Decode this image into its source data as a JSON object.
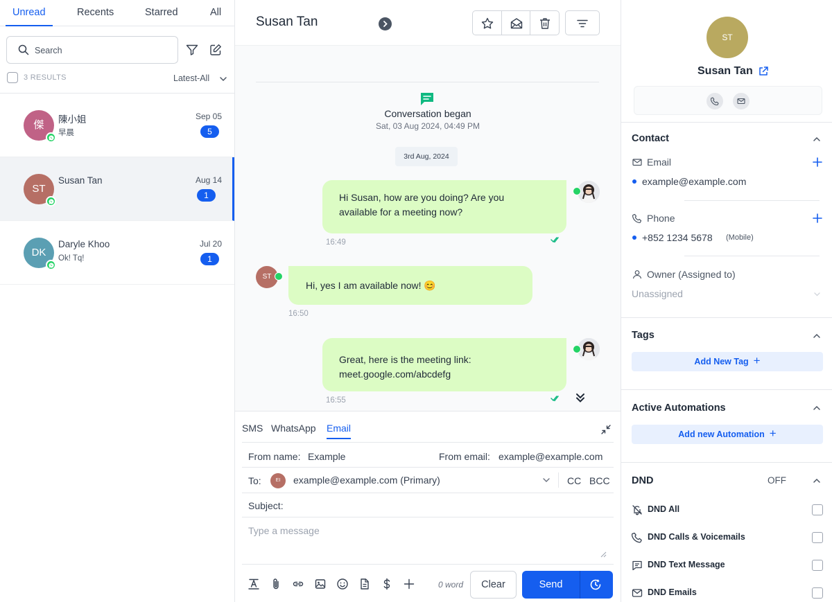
{
  "sidebar": {
    "tabs": [
      "Unread",
      "Recents",
      "Starred",
      "All"
    ],
    "search_placeholder": "Search",
    "results_label": "3 RESULTS",
    "sort_label": "Latest-All",
    "conversations": [
      {
        "initials": "傑",
        "name": "陳小姐",
        "preview": "早晨",
        "date": "Sep 05",
        "count": "5",
        "color": "#c06286"
      },
      {
        "initials": "ST",
        "name": "Susan Tan",
        "preview": "",
        "date": "Aug 14",
        "count": "1",
        "color": "#b66f65"
      },
      {
        "initials": "DK",
        "name": "Daryle Khoo",
        "preview": "Ok! Tq!",
        "date": "Jul 20",
        "count": "1",
        "color": "#5b9fb3"
      }
    ]
  },
  "header": {
    "title": "Susan Tan",
    "actions": [
      "star-icon",
      "mail-open-icon",
      "trash-icon",
      "filter-lines-icon"
    ]
  },
  "chat": {
    "began_title": "Conversation began",
    "began_date": "Sat, 03 Aug 2024, 04:49 PM",
    "day_pill": "3rd Aug, 2024",
    "messages": [
      {
        "direction": "out",
        "text": "Hi Susan, how are you doing? Are you available for a meeting now?",
        "time": "16:49"
      },
      {
        "direction": "in",
        "text": "Hi, yes I am available now! 😊",
        "time": "16:50",
        "avatar_initials": "ST"
      },
      {
        "direction": "out",
        "text": "Great, here is the meeting link: meet.google.com/abcdefg",
        "time": "16:55"
      }
    ]
  },
  "composer": {
    "tabs": [
      "SMS",
      "WhatsApp",
      "Email"
    ],
    "active_tab": "Email",
    "from_name_label": "From name:",
    "from_name_value": "Example",
    "from_email_label": "From email:",
    "from_email_value": "example@example.com",
    "to_label": "To:",
    "to_initials": "EI",
    "to_value": "example@example.com (Primary)",
    "cc_label": "CC",
    "bcc_label": "BCC",
    "subject_label": "Subject:",
    "message_placeholder": "Type a message",
    "word_count": "0 word",
    "clear_label": "Clear",
    "send_label": "Send"
  },
  "contact_panel": {
    "initials": "ST",
    "name": "Susan Tan",
    "contact_header": "Contact",
    "email_label": "Email",
    "email_value": "example@example.com",
    "phone_label": "Phone",
    "phone_value": "+852 1234 5678",
    "phone_type": "(Mobile)",
    "owner_label": "Owner (Assigned to)",
    "owner_value": "Unassigned",
    "tags_header": "Tags",
    "add_tag_label": "Add New Tag",
    "automations_header": "Active Automations",
    "add_automation_label": "Add new Automation",
    "dnd_header": "DND",
    "dnd_status": "OFF",
    "dnd_options": [
      "DND All",
      "DND Calls & Voicemails",
      "DND Text Message",
      "DND Emails"
    ]
  },
  "colors": {
    "accent": "#155eef",
    "bubble": "#dcfcc4",
    "whatsapp": "#25d366"
  }
}
